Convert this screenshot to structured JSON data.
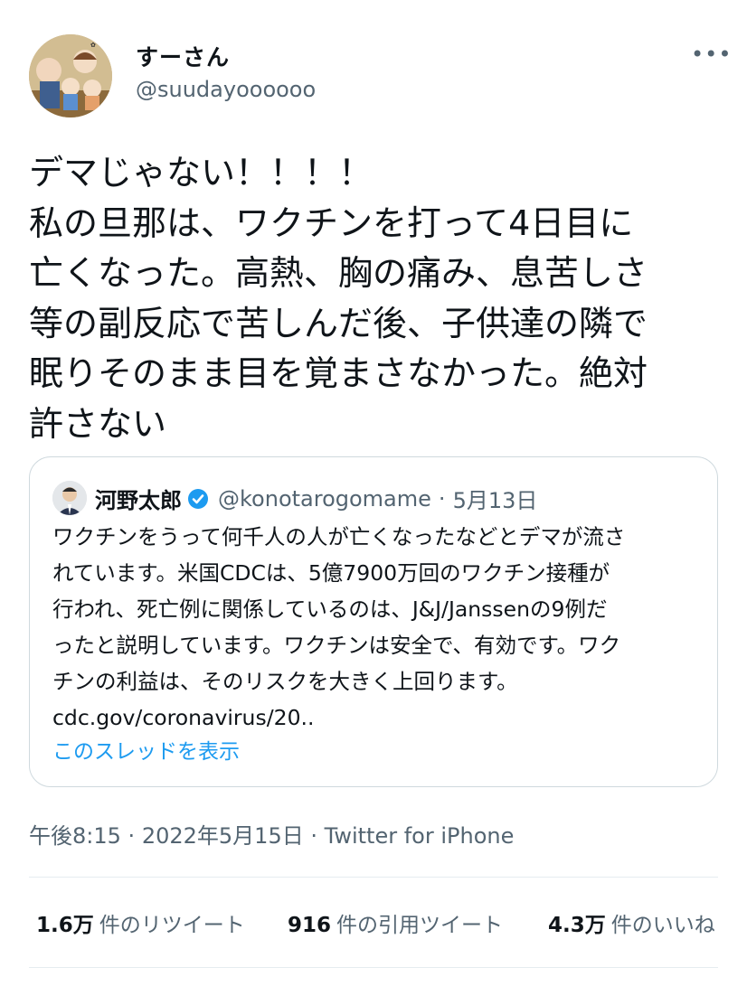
{
  "author": {
    "display_name": "すーさん",
    "handle": "@suudayoooooo",
    "avatar_icon": "avatar-illustration",
    "menu_icon": "more-icon",
    "menu_glyph": "•••"
  },
  "tweet": {
    "lines": [
      "デマじゃない！！！！",
      "私の旦那は、ワクチンを打って4日目に",
      "亡くなった。高熱、胸の痛み、息苦しさ",
      "等の副反応で苦しんだ後、子供達の隣で",
      "眠りそのまま目を覚まさなかった。絶対",
      "許さない"
    ]
  },
  "quoted_tweet": {
    "display_name": "河野太郎",
    "verified_icon": "verified-badge-icon",
    "handle": "@konotarogomame",
    "separator": "·",
    "date": "5月13日",
    "lines": [
      "ワクチンをうって何千人の人が亡くなったなどとデマが流さ",
      "れています。米国CDCは、5億7900万回のワクチン接種が",
      "行われ、死亡例に関係しているのは、J&J/Janssenの9例だ",
      "ったと説明しています。ワクチンは安全で、有効です。ワク",
      "チンの利益は、そのリスクを大きく上回ります。",
      "cdc.gov/coronavirus/20.."
    ],
    "show_thread_label": "このスレッドを表示"
  },
  "meta": {
    "time": "午後8:15",
    "date": "2022年5月15日",
    "separator": "·",
    "source": "Twitter for iPhone"
  },
  "stats": {
    "retweets_count": "1.6万",
    "retweets_label": "件のリツイート",
    "quotes_count": "916",
    "quotes_label": "件の引用ツイート",
    "likes_count": "4.3万",
    "likes_label": "件のいいね"
  },
  "colors": {
    "text": "#0f1419",
    "secondary": "#536471",
    "link": "#1d9bf0",
    "border": "#cfd9de"
  }
}
